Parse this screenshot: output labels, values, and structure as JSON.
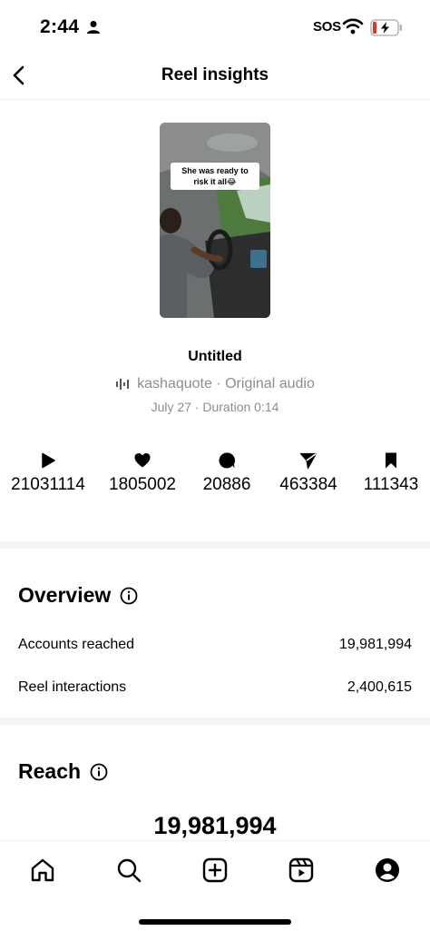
{
  "status_bar": {
    "time": "2:44",
    "sos": "SOS",
    "icons": [
      "person-icon",
      "wifi-icon",
      "battery-charging-icon"
    ],
    "battery_color": "#e0352b"
  },
  "header": {
    "title": "Reel insights",
    "back_icon": "chevron-left-icon"
  },
  "reel": {
    "caption_overlay": "She was ready to risk it all😂",
    "title": "Untitled",
    "audio": "kashaquote · Original audio",
    "meta": "July 27 · Duration 0:14"
  },
  "stats": [
    {
      "icon": "play-icon",
      "value": "21031114"
    },
    {
      "icon": "heart-icon",
      "value": "1805002"
    },
    {
      "icon": "comment-icon",
      "value": "20886"
    },
    {
      "icon": "share-icon",
      "value": "463384"
    },
    {
      "icon": "bookmark-icon",
      "value": "111343"
    }
  ],
  "overview": {
    "title": "Overview",
    "rows": [
      {
        "label": "Accounts reached",
        "value": "19,981,994"
      },
      {
        "label": "Reel interactions",
        "value": "2,400,615"
      }
    ]
  },
  "reach": {
    "title": "Reach",
    "total": "19,981,994"
  },
  "bottom_nav": {
    "items": [
      "home-icon",
      "search-icon",
      "create-icon",
      "reels-icon",
      "profile-icon"
    ]
  }
}
